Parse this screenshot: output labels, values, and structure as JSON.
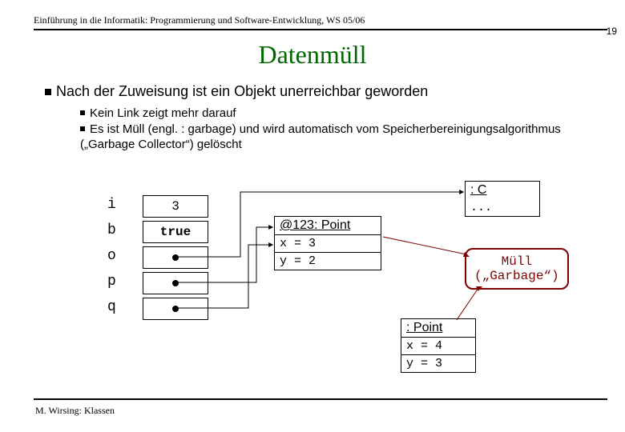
{
  "header": "Einführung in die Informatik: Programmierung und Software-Entwicklung, WS 05/06",
  "page_number": "19",
  "title": "Datenmüll",
  "main_bullet": "Nach der Zuweisung ist ein Objekt unerreichbar geworden",
  "sub_bullets": {
    "s0": "Kein Link zeigt mehr darauf",
    "s1": "Es ist Müll (engl. : garbage) und wird automatisch vom Speicherbereinigungsalgorithmus („Garbage Collector“) gelöscht"
  },
  "vars": {
    "i": {
      "name": "i",
      "value": "3"
    },
    "b": {
      "name": "b",
      "value": "true"
    },
    "o": {
      "name": "o"
    },
    "p": {
      "name": "p"
    },
    "q": {
      "name": "q"
    }
  },
  "obj_c": {
    "header": ": C",
    "body": "..."
  },
  "obj_point1": {
    "header": "@123: Point",
    "x_row": "x = 3",
    "y_row": "y = 2"
  },
  "obj_point2": {
    "header": ": Point",
    "x_row": "x = 4",
    "y_row": "y = 3"
  },
  "garbage": {
    "line1": "Müll",
    "line2": "(„Garbage“)"
  },
  "footer": "M. Wirsing: Klassen"
}
